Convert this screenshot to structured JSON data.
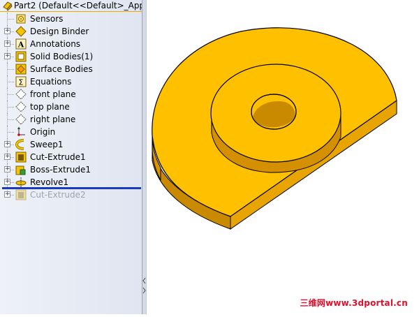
{
  "feature_tree": {
    "root": {
      "label": "Part2  (Default<<Default>_App",
      "icon": "part-icon"
    },
    "items": [
      {
        "label": "Sensors",
        "icon": "sensors-icon",
        "expandable": false,
        "suppressed": false
      },
      {
        "label": "Design Binder",
        "icon": "design-binder-icon",
        "expandable": true,
        "suppressed": false
      },
      {
        "label": "Annotations",
        "icon": "annotations-icon",
        "expandable": true,
        "suppressed": false
      },
      {
        "label": "Solid Bodies(1)",
        "icon": "solid-bodies-icon",
        "expandable": true,
        "suppressed": false
      },
      {
        "label": "Surface Bodies",
        "icon": "surface-bodies-icon",
        "expandable": false,
        "suppressed": false
      },
      {
        "label": "Equations",
        "icon": "equations-icon",
        "expandable": false,
        "suppressed": false
      },
      {
        "label": "front plane",
        "icon": "plane-icon",
        "expandable": false,
        "suppressed": false
      },
      {
        "label": "top plane",
        "icon": "plane-icon",
        "expandable": false,
        "suppressed": false
      },
      {
        "label": "right plane",
        "icon": "plane-icon",
        "expandable": false,
        "suppressed": false
      },
      {
        "label": "Origin",
        "icon": "origin-icon",
        "expandable": false,
        "suppressed": false
      },
      {
        "label": "Sweep1",
        "icon": "sweep-icon",
        "expandable": true,
        "suppressed": false
      },
      {
        "label": "Cut-Extrude1",
        "icon": "cut-extrude-icon",
        "expandable": true,
        "suppressed": false
      },
      {
        "label": "Boss-Extrude1",
        "icon": "boss-extrude-icon",
        "expandable": true,
        "suppressed": false
      },
      {
        "label": "Revolve1",
        "icon": "revolve-icon",
        "expandable": true,
        "suppressed": false
      },
      {
        "label": "Cut-Extrude2",
        "icon": "cut-extrude-icon",
        "expandable": true,
        "suppressed": true
      }
    ]
  },
  "colors": {
    "model_face": "#ffc000",
    "model_side": "#e8a400",
    "model_dark": "#c98a00",
    "rollback_bar": "#1a3bbd",
    "watermark": "#e0102a"
  },
  "watermark": {
    "text": "三维网www.3dportal.cn"
  }
}
